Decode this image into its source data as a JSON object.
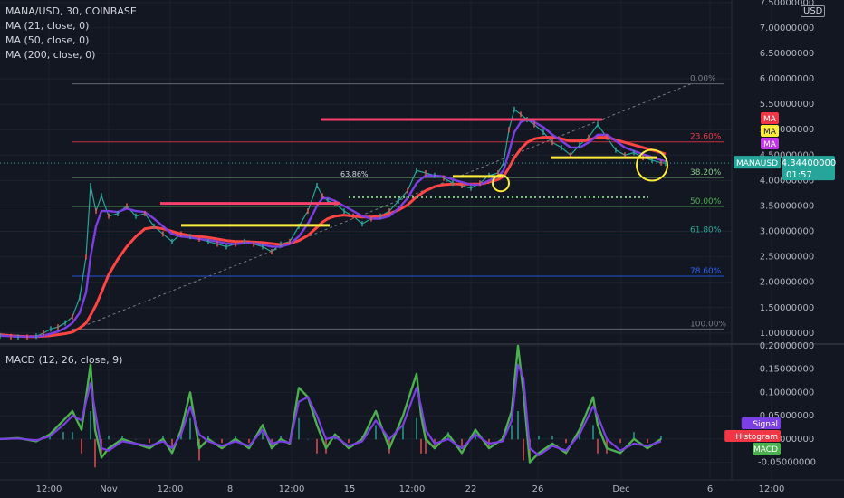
{
  "chart_title": "MANA/USD, 30, COINBASE",
  "indicators": [
    "MA (21, close, 0)",
    "MA (50, close, 0)",
    "MA (200, close, 0)"
  ],
  "macd_label": "MACD (12, 26, close, 9)",
  "currency_label": "USD",
  "colors": {
    "bg": "#131722",
    "grid": "#1e222d",
    "ma21": "#7b3fe4",
    "ma50": "#ff4444",
    "price": "#26a69a",
    "fib100": "#787b86",
    "fib786": "#2962ff",
    "fib618": "#26a69a",
    "fib50": "#4caf50",
    "fib382": "#81c784",
    "fib236": "#f23645",
    "fib0": "#787b86",
    "yellow": "#ffeb3b",
    "pink": "#f6416c",
    "macd": "#4caf50",
    "signal": "#7b3fe4"
  },
  "chart_data": [
    {
      "type": "line",
      "title": "MANA/USD, 30, COINBASE",
      "x_ticks": [
        "12:00",
        "Nov",
        "12:00",
        "8",
        "12:00",
        "15",
        "12:00",
        "22",
        "26",
        "Dec",
        "6",
        "12:00"
      ],
      "y_ticks": [
        "7.50000000",
        "7.00000000",
        "6.50000000",
        "6.00000000",
        "5.50000000",
        "5.00000000",
        "4.50000000",
        "4.00000000",
        "3.50000000",
        "3.00000000",
        "2.50000000",
        "2.00000000",
        "1.50000000",
        "1.00000000"
      ],
      "ylim": [
        0.82,
        7.55
      ],
      "x": [
        0,
        12,
        20,
        30,
        40,
        48,
        56,
        64,
        72,
        80,
        88,
        95,
        100,
        106,
        112,
        120,
        130,
        140,
        150,
        160,
        170,
        180,
        190,
        200,
        210,
        220,
        230,
        240,
        250,
        260,
        270,
        280,
        290,
        300,
        310,
        320,
        330,
        340,
        350,
        356,
        362,
        370,
        380,
        390,
        400,
        410,
        420,
        430,
        440,
        450,
        460,
        470,
        480,
        490,
        500,
        510,
        520,
        530,
        540,
        550,
        556,
        562,
        568,
        575,
        582,
        590,
        600,
        610,
        620,
        630,
        640,
        650,
        660,
        670,
        680,
        690,
        700,
        710,
        720,
        730,
        735
      ],
      "price": [
        0.95,
        0.93,
        0.92,
        0.92,
        0.94,
        1.0,
        1.08,
        1.12,
        1.2,
        1.32,
        1.7,
        2.5,
        3.9,
        3.4,
        3.7,
        3.3,
        3.35,
        3.5,
        3.3,
        3.35,
        3.1,
        2.95,
        2.8,
        2.95,
        2.9,
        2.85,
        2.8,
        2.75,
        2.7,
        2.75,
        2.8,
        2.75,
        2.7,
        2.6,
        2.75,
        2.8,
        3.1,
        3.4,
        3.9,
        3.7,
        3.6,
        3.55,
        3.4,
        3.3,
        3.15,
        3.25,
        3.3,
        3.4,
        3.6,
        3.8,
        4.2,
        4.15,
        4.1,
        4.05,
        3.95,
        3.9,
        3.85,
        3.95,
        4.1,
        4.15,
        4.35,
        5.0,
        5.4,
        5.3,
        5.2,
        5.1,
        4.95,
        4.75,
        4.65,
        4.5,
        4.7,
        4.85,
        5.1,
        4.85,
        4.6,
        4.5,
        4.55,
        4.45,
        4.4,
        4.35,
        4.34
      ],
      "ma21": [
        0.95,
        0.94,
        0.93,
        0.93,
        0.93,
        0.95,
        0.99,
        1.03,
        1.1,
        1.2,
        1.4,
        1.8,
        2.5,
        3.1,
        3.4,
        3.4,
        3.38,
        3.45,
        3.4,
        3.38,
        3.25,
        3.1,
        2.95,
        2.9,
        2.88,
        2.85,
        2.83,
        2.8,
        2.76,
        2.75,
        2.77,
        2.77,
        2.74,
        2.7,
        2.7,
        2.75,
        2.9,
        3.15,
        3.5,
        3.65,
        3.65,
        3.6,
        3.5,
        3.4,
        3.3,
        3.25,
        3.25,
        3.3,
        3.45,
        3.65,
        3.95,
        4.1,
        4.1,
        4.08,
        4.02,
        3.97,
        3.92,
        3.92,
        4.0,
        4.08,
        4.2,
        4.55,
        4.95,
        5.15,
        5.2,
        5.15,
        5.05,
        4.9,
        4.78,
        4.65,
        4.65,
        4.75,
        4.9,
        4.9,
        4.78,
        4.65,
        4.58,
        4.52,
        4.46,
        4.4,
        4.38
      ],
      "ma50": [
        0.97,
        0.95,
        0.94,
        0.93,
        0.93,
        0.94,
        0.95,
        0.97,
        0.99,
        1.02,
        1.1,
        1.2,
        1.35,
        1.55,
        1.8,
        2.15,
        2.45,
        2.7,
        2.9,
        3.05,
        3.08,
        3.05,
        3.0,
        2.95,
        2.92,
        2.9,
        2.88,
        2.85,
        2.82,
        2.8,
        2.8,
        2.79,
        2.78,
        2.76,
        2.74,
        2.76,
        2.82,
        2.92,
        3.08,
        3.18,
        3.25,
        3.3,
        3.32,
        3.3,
        3.28,
        3.28,
        3.3,
        3.35,
        3.42,
        3.52,
        3.68,
        3.8,
        3.88,
        3.92,
        3.93,
        3.93,
        3.93,
        3.93,
        3.97,
        4.02,
        4.08,
        4.25,
        4.45,
        4.62,
        4.75,
        4.82,
        4.85,
        4.85,
        4.82,
        4.78,
        4.78,
        4.8,
        4.85,
        4.85,
        4.8,
        4.75,
        4.7,
        4.65,
        4.6,
        4.55,
        4.52
      ]
    },
    {
      "type": "line",
      "title": "MACD (12, 26, close, 9)",
      "y_ticks": [
        "0.20000000",
        "0.15000000",
        "0.10000000",
        "0.05000000",
        "0.00000000",
        "-0.05000000"
      ],
      "ylim": [
        -0.08,
        0.2
      ],
      "x": [
        0,
        20,
        40,
        55,
        70,
        80,
        90,
        100,
        105,
        112,
        120,
        135,
        150,
        165,
        180,
        190,
        200,
        210,
        220,
        230,
        245,
        260,
        275,
        290,
        300,
        310,
        320,
        330,
        340,
        350,
        360,
        370,
        385,
        400,
        415,
        430,
        445,
        460,
        465,
        470,
        480,
        495,
        510,
        525,
        540,
        555,
        565,
        572,
        578,
        585,
        595,
        610,
        625,
        640,
        655,
        660,
        670,
        685,
        700,
        715,
        730
      ],
      "macd": [
        0.0,
        0.002,
        -0.005,
        0.01,
        0.04,
        0.06,
        0.02,
        0.16,
        0.02,
        -0.04,
        -0.02,
        0.0,
        -0.01,
        -0.02,
        0.0,
        -0.03,
        0.02,
        0.1,
        -0.02,
        0.0,
        -0.02,
        0.0,
        -0.02,
        0.03,
        -0.02,
        0.0,
        -0.01,
        0.11,
        0.09,
        0.03,
        -0.02,
        0.01,
        -0.02,
        0.0,
        0.06,
        -0.02,
        0.05,
        0.14,
        0.05,
        0.0,
        -0.02,
        0.01,
        -0.03,
        0.02,
        -0.02,
        0.0,
        0.06,
        0.2,
        0.1,
        -0.05,
        -0.03,
        -0.01,
        -0.03,
        0.02,
        0.09,
        0.03,
        -0.02,
        -0.03,
        0.0,
        -0.02,
        0.0
      ],
      "signal": [
        0.0,
        0.001,
        -0.003,
        0.006,
        0.03,
        0.05,
        0.04,
        0.12,
        0.06,
        -0.02,
        -0.025,
        -0.005,
        -0.01,
        -0.015,
        -0.005,
        -0.02,
        0.01,
        0.07,
        0.01,
        -0.005,
        -0.015,
        -0.005,
        -0.015,
        0.02,
        -0.01,
        -0.005,
        -0.008,
        0.08,
        0.09,
        0.05,
        0.0,
        0.005,
        -0.015,
        -0.005,
        0.04,
        0.0,
        0.03,
        0.11,
        0.07,
        0.02,
        -0.01,
        0.0,
        -0.02,
        0.01,
        -0.01,
        -0.005,
        0.04,
        0.16,
        0.13,
        -0.02,
        -0.035,
        -0.015,
        -0.025,
        0.01,
        0.07,
        0.05,
        0.0,
        -0.025,
        -0.01,
        -0.015,
        -0.005
      ]
    }
  ],
  "fib_levels": [
    {
      "label": "0.00%",
      "price": 5.9,
      "color": "#787b86"
    },
    {
      "label": "23.60%",
      "price": 4.76,
      "color": "#f23645"
    },
    {
      "label": "38.20%",
      "price": 4.06,
      "color": "#81c784"
    },
    {
      "label": "50.00%",
      "price": 3.49,
      "color": "#4caf50"
    },
    {
      "label": "61.80%",
      "price": 2.93,
      "color": "#26a69a"
    },
    {
      "label": "78.60%",
      "price": 2.12,
      "color": "#2962ff"
    },
    {
      "label": "100.00%",
      "price": 1.08,
      "color": "#787b86"
    }
  ],
  "annotations": {
    "pink_lines": [
      {
        "x1": 177,
        "x2": 376,
        "price": 3.55
      },
      {
        "x1": 354,
        "x2": 665,
        "price": 5.2
      }
    ],
    "yellow_lines": [
      {
        "x1": 200,
        "x2": 364,
        "price": 3.12
      },
      {
        "x1": 608,
        "x2": 726,
        "price": 4.45
      },
      {
        "x1": 500,
        "x2": 555,
        "price": 4.08
      }
    ],
    "dotted_line": {
      "x1": 385,
      "x2": 716,
      "price": 3.67
    },
    "circles": [
      {
        "cx": 553,
        "price": 3.95,
        "r": 9
      },
      {
        "cx": 720,
        "price": 4.3,
        "r": 17
      }
    ],
    "trend": {
      "x1": 80,
      "y_price1": 1.05,
      "x2": 763,
      "y_price2": 5.9
    },
    "small_label": "63.86%"
  },
  "right_badges": {
    "ma_labels": [
      "MA",
      "MA",
      "MA"
    ],
    "ma_colors": [
      "#f23645",
      "#ffeb3b",
      "#c235e8"
    ],
    "symbol": "MANAUSD",
    "last_price": "4.34400000",
    "countdown": "01:57",
    "macd_badges": [
      {
        "label": "Signal",
        "color": "#7b3fe4"
      },
      {
        "label": "Histogram",
        "color": "#f23645"
      },
      {
        "label": "MACD",
        "color": "#4caf50"
      }
    ]
  }
}
